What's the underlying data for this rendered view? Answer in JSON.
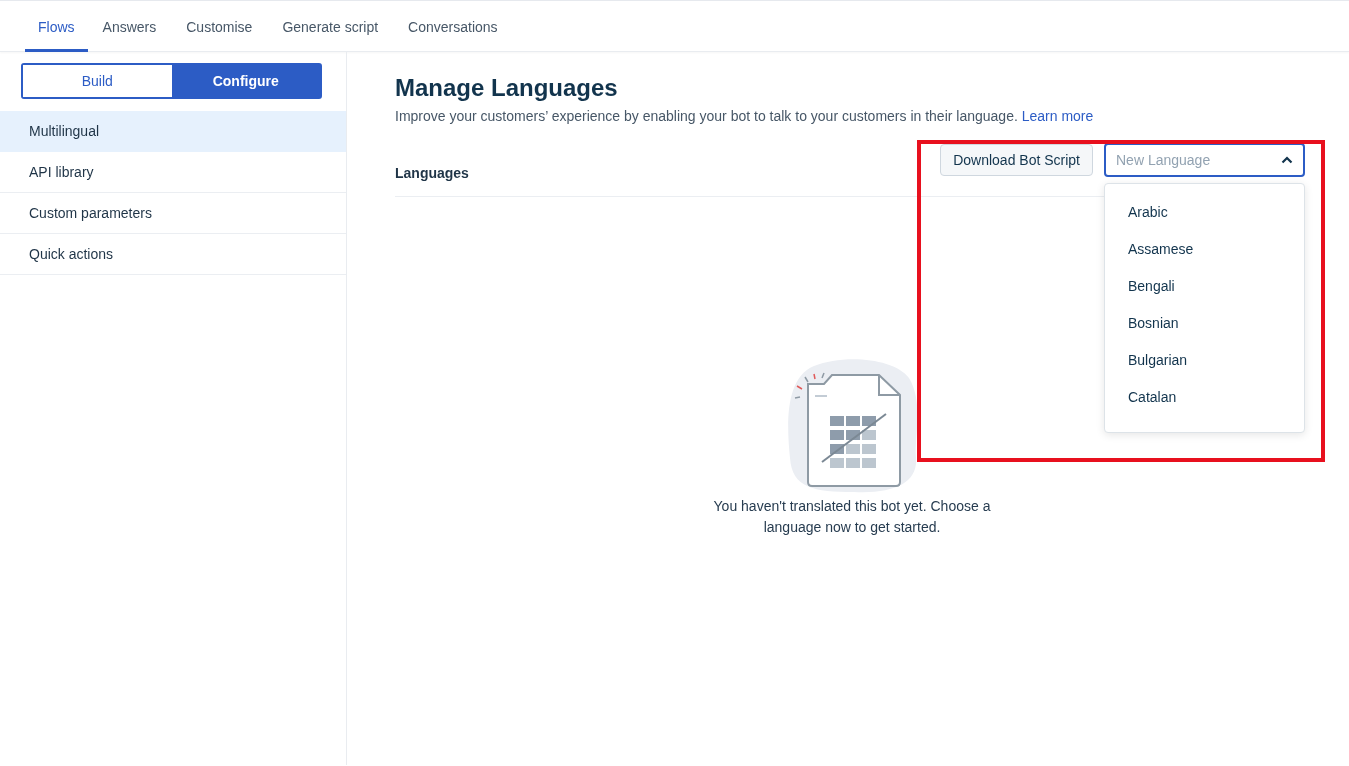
{
  "tabs": [
    {
      "label": "Flows",
      "selected": true
    },
    {
      "label": "Answers",
      "selected": false
    },
    {
      "label": "Customise",
      "selected": false
    },
    {
      "label": "Generate script",
      "selected": false
    },
    {
      "label": "Conversations",
      "selected": false
    }
  ],
  "mode_switch": [
    {
      "label": "Build",
      "selected": false
    },
    {
      "label": "Configure",
      "selected": true
    }
  ],
  "sidebar": {
    "items": [
      {
        "label": "Multilingual",
        "selected": true
      },
      {
        "label": "API library",
        "selected": false
      },
      {
        "label": "Custom parameters",
        "selected": false
      },
      {
        "label": "Quick actions",
        "selected": false
      }
    ]
  },
  "page": {
    "title": "Manage Languages",
    "description": "Improve your customers’ experience by enabling your bot to talk to your customers in their language.",
    "link": "Learn more"
  },
  "languages": {
    "heading": "Languages",
    "download_button": "Download Bot Script",
    "language_select": {
      "placeholder": "New Language",
      "expanded": true,
      "options": [
        "Arabic",
        "Assamese",
        "Bengali",
        "Bosnian",
        "Bulgarian",
        "Catalan"
      ]
    }
  },
  "empty_state": {
    "message": "You haven't translated this bot yet. Choose a language now to get started."
  }
}
